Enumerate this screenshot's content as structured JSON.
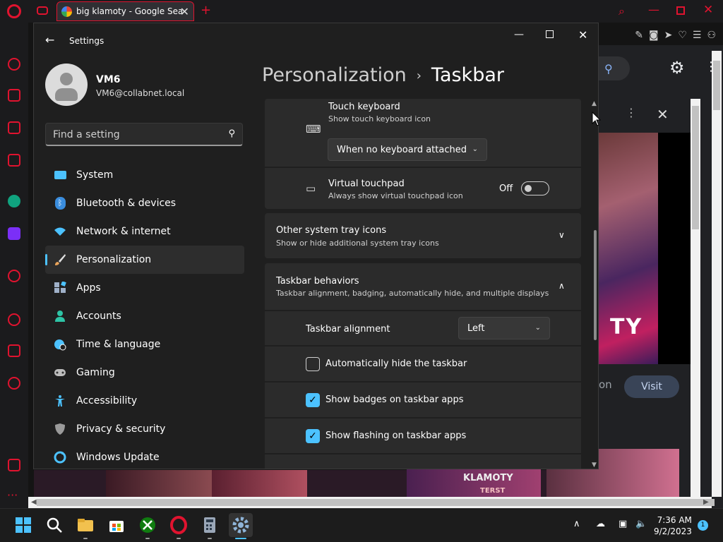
{
  "browser": {
    "tab_title": "big klamoty - Google Search",
    "new_tab_label": "+"
  },
  "google": {
    "video_text": "TY",
    "snippet_fragment": "on",
    "visit_label": "Visit",
    "thumb_text_1": "KLAMOTY",
    "thumb_text_2": "TERST"
  },
  "settings": {
    "app_title": "Settings",
    "user": {
      "name": "VM6",
      "email": "VM6@collabnet.local"
    },
    "search_placeholder": "Find a setting",
    "nav": [
      {
        "label": "System",
        "icon": "monitor-icon",
        "color": "#4cc2ff"
      },
      {
        "label": "Bluetooth & devices",
        "icon": "bluetooth-icon",
        "color": "#3a8dde"
      },
      {
        "label": "Network & internet",
        "icon": "wifi-icon",
        "color": "#4cc2ff"
      },
      {
        "label": "Personalization",
        "icon": "brush-icon",
        "color": "#e8a35a"
      },
      {
        "label": "Apps",
        "icon": "apps-icon",
        "color": "#9fb0c8"
      },
      {
        "label": "Accounts",
        "icon": "person-icon",
        "color": "#2ec4a6"
      },
      {
        "label": "Time & language",
        "icon": "globe-clock-icon",
        "color": "#4cc2ff"
      },
      {
        "label": "Gaming",
        "icon": "gamepad-icon",
        "color": "#bdbdbd"
      },
      {
        "label": "Accessibility",
        "icon": "accessibility-icon",
        "color": "#4cc2ff"
      },
      {
        "label": "Privacy & security",
        "icon": "shield-icon",
        "color": "#9a9a9a"
      },
      {
        "label": "Windows Update",
        "icon": "update-icon",
        "color": "#4cc2ff"
      }
    ],
    "active_nav": "Personalization",
    "breadcrumb": {
      "parent": "Personalization",
      "separator": "›",
      "current": "Taskbar"
    },
    "touch_keyboard": {
      "title": "Touch keyboard",
      "subtitle": "Show touch keyboard icon",
      "dropdown_value": "When no keyboard attached"
    },
    "virtual_touchpad": {
      "title": "Virtual touchpad",
      "subtitle": "Always show virtual touchpad icon",
      "state_label": "Off"
    },
    "other_tray": {
      "title": "Other system tray icons",
      "subtitle": "Show or hide additional system tray icons"
    },
    "behaviors": {
      "title": "Taskbar behaviors",
      "subtitle": "Taskbar alignment, badging, automatically hide, and multiple displays",
      "alignment_label": "Taskbar alignment",
      "alignment_value": "Left",
      "auto_hide_label": "Automatically hide the taskbar",
      "auto_hide_checked": false,
      "badges_label": "Show badges on taskbar apps",
      "badges_checked": true,
      "flashing_label": "Show flashing on taskbar apps",
      "flashing_checked": true
    },
    "accent_color": "#4cc2ff"
  },
  "taskbar": {
    "time": "7:36 AM",
    "date": "9/2/2023",
    "notification_count": "1"
  }
}
